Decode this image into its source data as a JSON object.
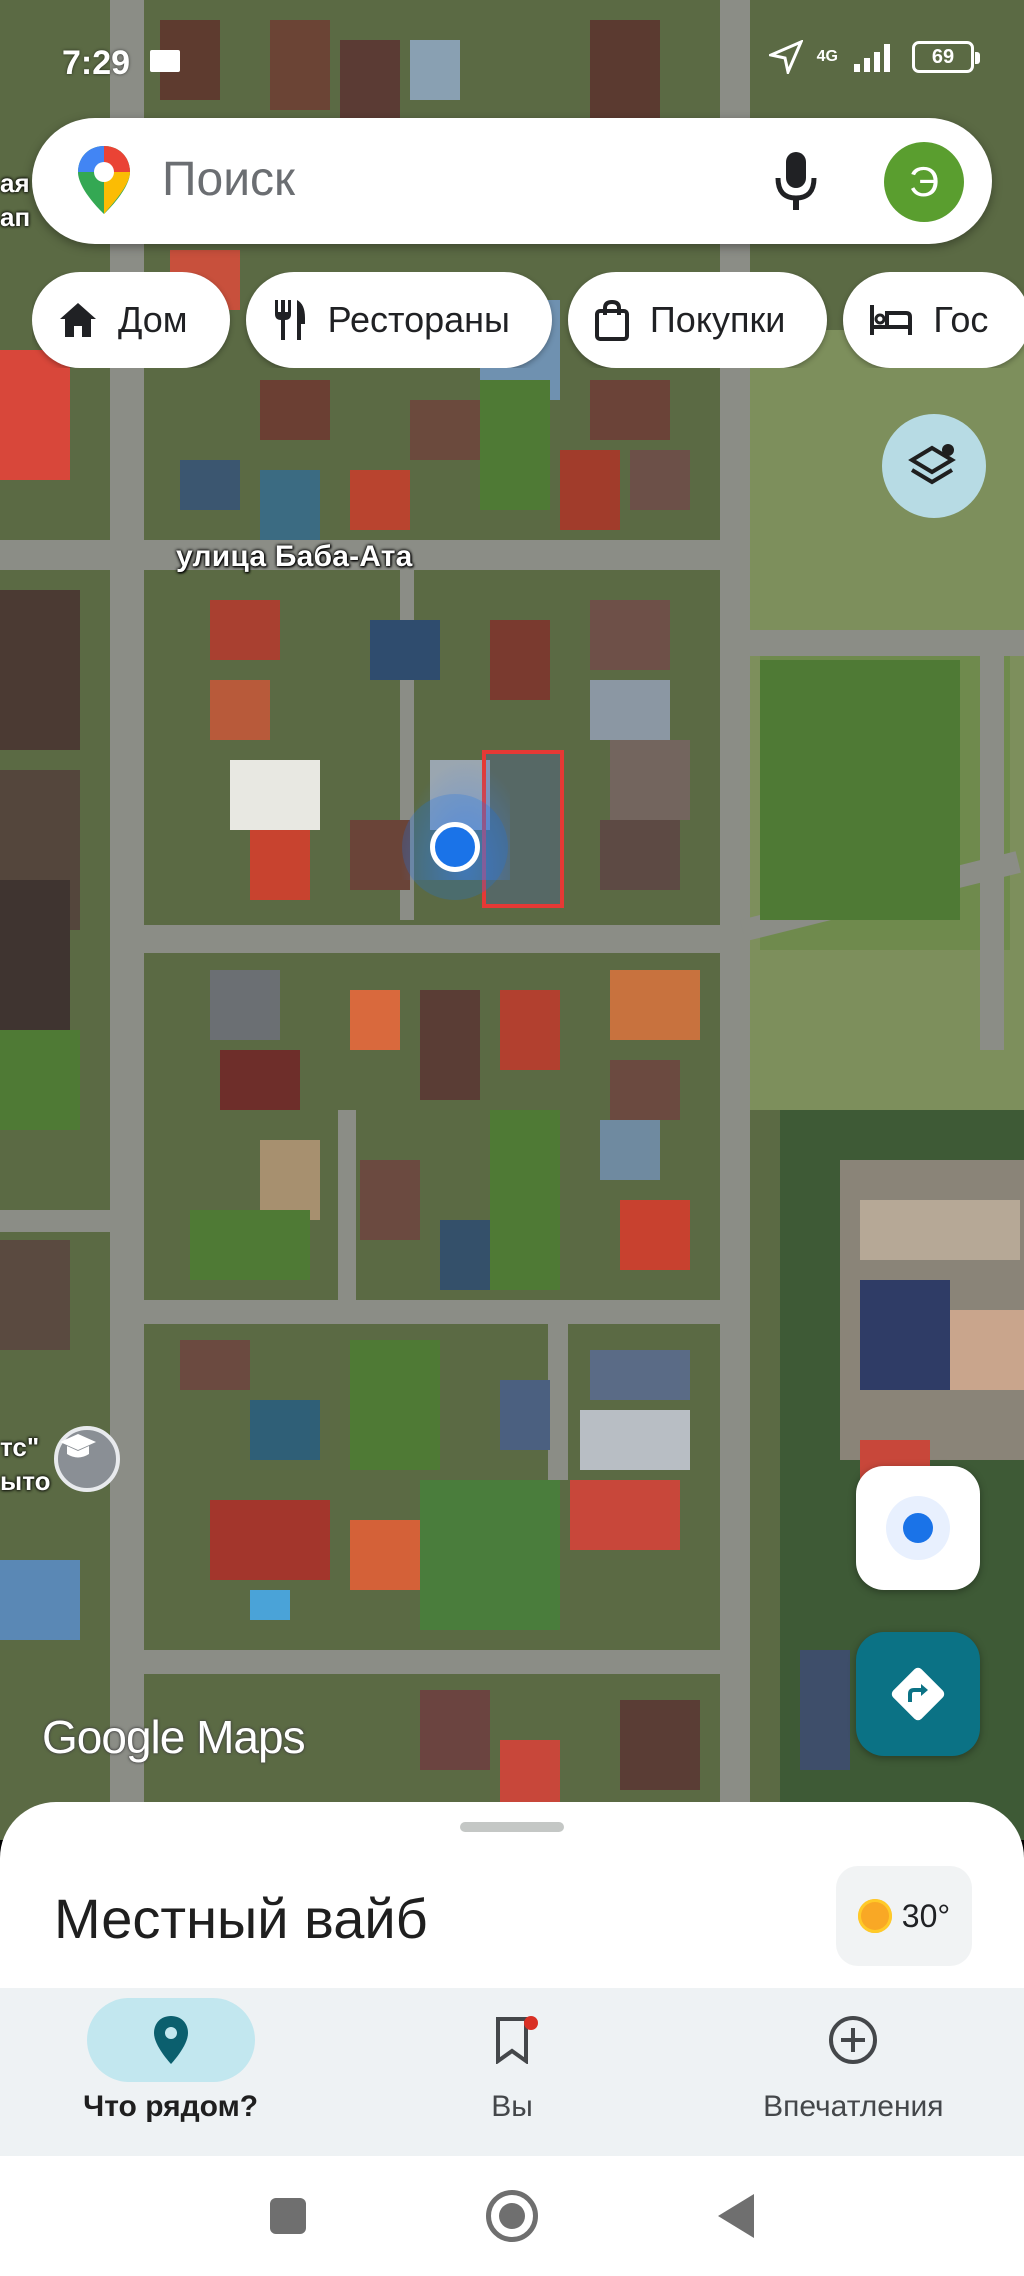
{
  "status_bar": {
    "time": "7:29",
    "network": "4G",
    "battery": "69"
  },
  "search": {
    "placeholder": "Поиск",
    "avatar_initial": "Э"
  },
  "chips": [
    {
      "label": "Дом",
      "icon": "home-icon"
    },
    {
      "label": "Рестораны",
      "icon": "restaurant-icon"
    },
    {
      "label": "Покупки",
      "icon": "shopping-bag-icon"
    },
    {
      "label": "Гос",
      "icon": "hotel-icon"
    }
  ],
  "map": {
    "street_label": "улица Баба-Ата",
    "poi_partial_top": "ая",
    "poi_partial_top2": "ап",
    "poi_partial_left": "тс\"",
    "poi_partial_left2": "ыто",
    "logo": "Google Maps"
  },
  "sheet": {
    "title": "Местный вайб",
    "weather_temp": "30°"
  },
  "bottom_nav": [
    {
      "label": "Что рядом?",
      "icon": "location-pin-icon",
      "active": true
    },
    {
      "label": "Вы",
      "icon": "bookmark-icon",
      "active": false,
      "badge": true
    },
    {
      "label": "Впечатления",
      "icon": "add-circle-icon",
      "active": false
    }
  ],
  "colors": {
    "accent": "#1a73e8",
    "directions": "#0b7285",
    "nav_active": "#c2e7ef",
    "boundary": "#e53935"
  }
}
